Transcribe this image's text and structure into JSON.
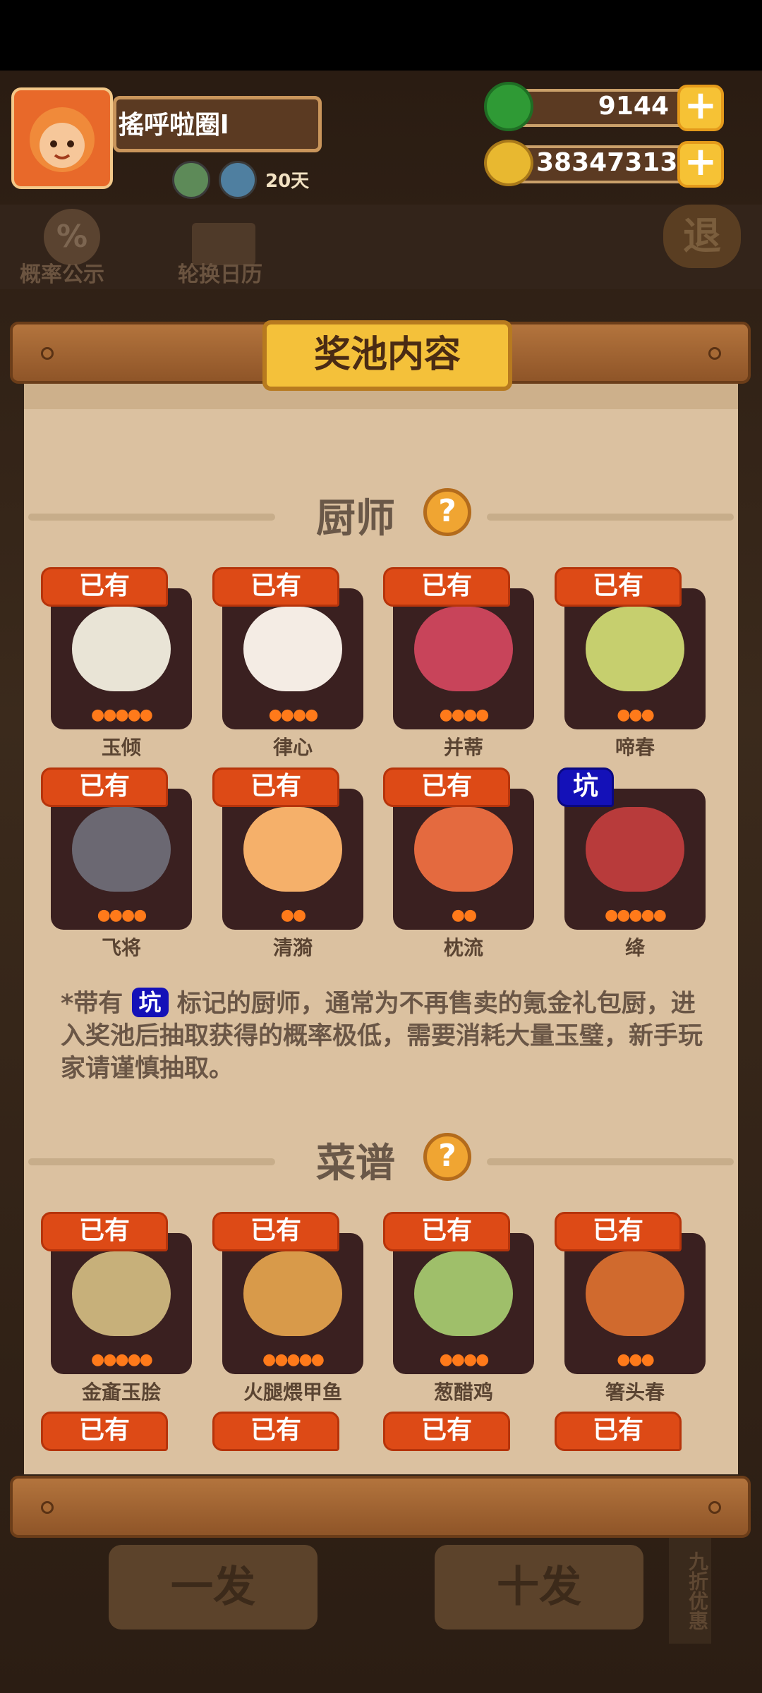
{
  "header": {
    "player_name": "搖呼啦圈l",
    "days_label": "20天",
    "jade": {
      "value": "9144",
      "icon": "jade-coin-icon"
    },
    "gold": {
      "value": "38347313",
      "icon": "gold-coin-icon"
    }
  },
  "top_buttons": {
    "probability": "概率公示",
    "calendar": "轮换日历",
    "exit": "退"
  },
  "panel": {
    "title": "奖池内容",
    "chef_section": "厨师",
    "recipe_section": "菜谱",
    "help": "?"
  },
  "chefs": [
    {
      "name": "玉倾",
      "tag": "已有",
      "stars": 5,
      "color": "#e9e4d6"
    },
    {
      "name": "律心",
      "tag": "已有",
      "stars": 4,
      "color": "#f4ece4"
    },
    {
      "name": "并蒂",
      "tag": "已有",
      "stars": 4,
      "color": "#c8445a"
    },
    {
      "name": "啼春",
      "tag": "已有",
      "stars": 3,
      "color": "#c6cf6e"
    },
    {
      "name": "飞将",
      "tag": "已有",
      "stars": 4,
      "color": "#6b6872"
    },
    {
      "name": "清漪",
      "tag": "已有",
      "stars": 2,
      "color": "#f5b06a"
    },
    {
      "name": "枕流",
      "tag": "已有",
      "stars": 2,
      "color": "#e46a3f"
    },
    {
      "name": "绛",
      "tag": "坑",
      "stars": 5,
      "color": "#b83b3b"
    }
  ],
  "note": {
    "prefix": "*带有",
    "pit": "坑",
    "text": "标记的厨师，通常为不再售卖的氪金礼包厨，进入奖池后抽取获得的概率极低，需要消耗大量玉璧，新手玩家请谨慎抽取。"
  },
  "recipes": [
    {
      "name": "金齑玉脍",
      "tag": "已有",
      "stars": 5,
      "color": "#c7b07a"
    },
    {
      "name": "火腿煨甲鱼",
      "tag": "已有",
      "stars": 5,
      "color": "#d89a4a"
    },
    {
      "name": "葱醋鸡",
      "tag": "已有",
      "stars": 4,
      "color": "#9fbf6a"
    },
    {
      "name": "箸头春",
      "tag": "已有",
      "stars": 3,
      "color": "#d06a2e"
    }
  ],
  "partial_tags": [
    "已有",
    "已有",
    "已有",
    "已有"
  ],
  "bottom": {
    "single": "一发",
    "ten": "十发",
    "discount": "九折优惠"
  }
}
